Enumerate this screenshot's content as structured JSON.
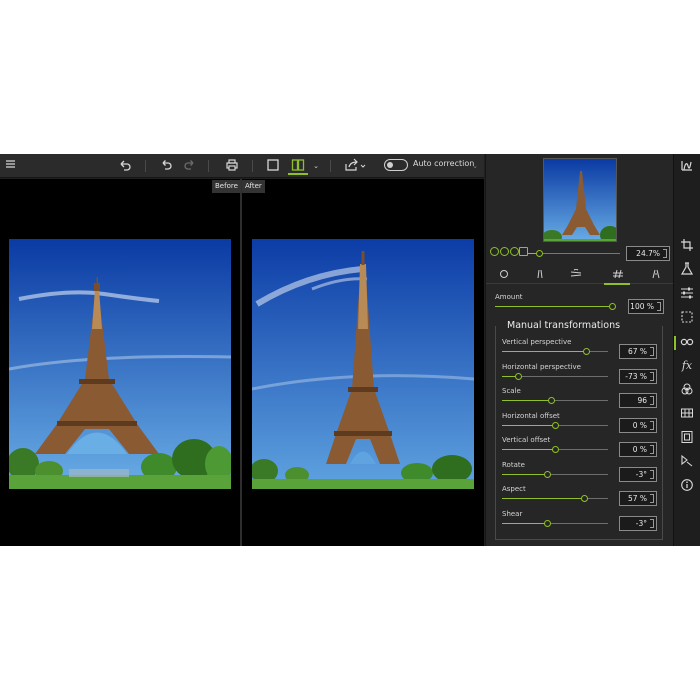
{
  "toolbar": {
    "menu_icon": "hamburger-icon",
    "undo_icon": "back-arrow-icon",
    "auto_correction_label": "Auto correction"
  },
  "compare": {
    "before_label": "Before",
    "after_label": "After"
  },
  "navigator": {
    "zoom_value": "24.7%",
    "zoom_fraction": 0.12
  },
  "amount": {
    "label": "Amount",
    "value": "100 %",
    "fraction": 1.0
  },
  "manual": {
    "title": "Manual transformations",
    "sliders": [
      {
        "label": "Vertical perspective",
        "value": "67 %",
        "fraction": 0.8
      },
      {
        "label": "Horizontal perspective",
        "value": "-73 %",
        "fraction": 0.16
      },
      {
        "label": "Scale",
        "value": "96",
        "fraction": 0.47
      },
      {
        "label": "Horizontal offset",
        "value": "0 %",
        "fraction": 0.5
      },
      {
        "label": "Vertical offset",
        "value": "0 %",
        "fraction": 0.5
      },
      {
        "label": "Rotate",
        "value": "-3°",
        "fraction": 0.43
      },
      {
        "label": "Aspect",
        "value": "57 %",
        "fraction": 0.78
      },
      {
        "label": "Shear",
        "value": "-3°",
        "fraction": 0.43
      }
    ]
  },
  "colors": {
    "accent": "#8fbf2a",
    "panel": "#262626",
    "sky_top": "#0d3fa8",
    "sky_bottom": "#5fa3e0",
    "tower": "#8a5a32"
  }
}
